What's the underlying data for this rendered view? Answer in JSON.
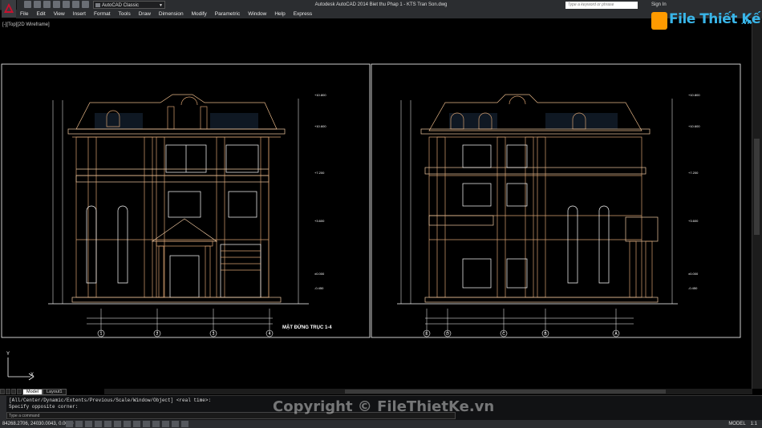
{
  "window": {
    "title": "Autodesk AutoCAD 2014    Biet thu Phap 1 - KTS Tran Son.dwg",
    "workspace": "AutoCAD Classic",
    "search_placeholder": "Type a keyword or phrase",
    "signin": "Sign In"
  },
  "menu": [
    "File",
    "Edit",
    "View",
    "Insert",
    "Format",
    "Tools",
    "Draw",
    "Dimension",
    "Modify",
    "Parametric",
    "Window",
    "Help",
    "Express"
  ],
  "viewport": {
    "label": "[-][Top][2D Wireframe]",
    "left_view": {
      "title": "MẶT ĐỨNG TRỤC 1-4",
      "axes": [
        "1",
        "2",
        "3",
        "4"
      ],
      "levels": [
        "+10.800",
        "+10.600",
        "+7.200",
        "+3.600",
        "±0.000",
        "-0.450"
      ]
    },
    "right_view": {
      "axes": [
        "E",
        "D",
        "C",
        "B",
        "A"
      ],
      "levels": [
        "+10.800",
        "+10.600",
        "+7.200",
        "+3.600",
        "±0.000",
        "-0.450"
      ]
    }
  },
  "tabs": [
    "Model",
    "Layout1"
  ],
  "command": {
    "line1": "[All/Center/Dynamic/Extents/Previous/Scale/Window/Object] <real time>:",
    "line2": "Specify opposite corner:",
    "input_placeholder": "Type a command"
  },
  "status": {
    "coords": "84268.2706, 24030.0043, 0.0000",
    "mode": "MODEL",
    "scale": "1:1"
  },
  "watermark": "Copyright © FileThietKe.vn",
  "brand": {
    "name": "File Thiết Kế",
    "domain": ".vn"
  },
  "colors": {
    "drawing_line": "#d6a070",
    "grid": "#ffffff",
    "background": "#000000"
  }
}
